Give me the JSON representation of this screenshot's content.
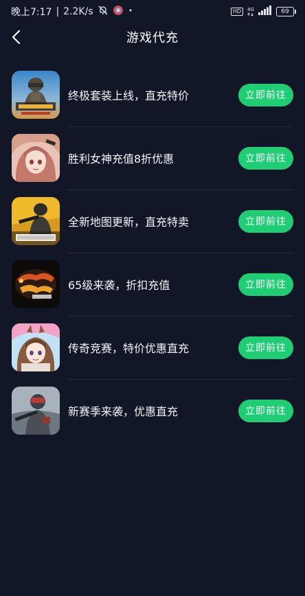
{
  "status_bar": {
    "time": "晚上7:17",
    "speed": "2.2K/s",
    "separator": "|",
    "hd": "HD",
    "network": "4G",
    "battery": "69"
  },
  "header": {
    "title": "游戏代充"
  },
  "items": [
    {
      "title": "终极套装上线，直充特价",
      "button": "立即前往",
      "icon": "pubg-battlegrounds-icon"
    },
    {
      "title": "胜利女神充值8折优惠",
      "button": "立即前往",
      "icon": "nikke-goddess-icon"
    },
    {
      "title": "全新地图更新，直充特卖",
      "button": "立即前往",
      "icon": "pubg-new-state-icon"
    },
    {
      "title": "65级来袭，折扣充值",
      "button": "立即前往",
      "icon": "dungeon-fighter-icon"
    },
    {
      "title": "传奇竞赛，特价优惠直充",
      "button": "立即前往",
      "icon": "uma-musume-icon"
    },
    {
      "title": "新赛季来袭，优惠直充",
      "button": "立即前往",
      "icon": "soldier-game-icon"
    }
  ]
}
